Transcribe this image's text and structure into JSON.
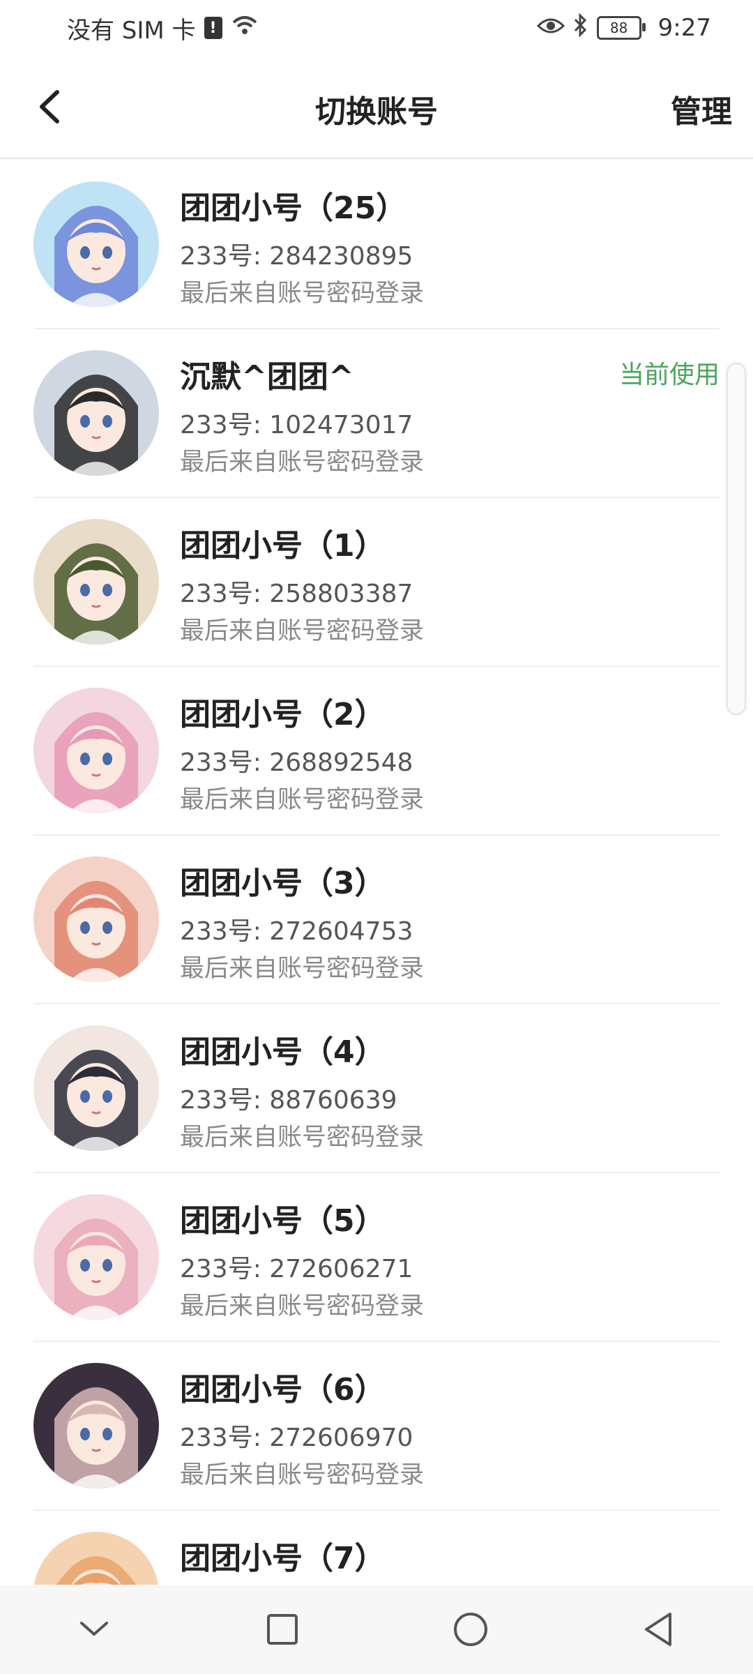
{
  "status_bar": {
    "carrier": "没有 SIM 卡",
    "sim_alert": "!",
    "battery": "88",
    "time": "9:27"
  },
  "header": {
    "title": "切换账号",
    "manage_label": "管理"
  },
  "accounts": [
    {
      "name": "团团小号（25）",
      "id": "233号: 284230895",
      "login": "最后来自账号密码登录",
      "current": "",
      "avatar_bg": "#bfe3f5",
      "avatar_fg": "#6d86d8"
    },
    {
      "name": "沉默^团团^",
      "id": "233号: 102473017",
      "login": "最后来自账号密码登录",
      "current": "当前使用",
      "avatar_bg": "#cfd8e2",
      "avatar_fg": "#2a2a2a"
    },
    {
      "name": "团团小号（1）",
      "id": "233号: 258803387",
      "login": "最后来自账号密码登录",
      "current": "",
      "avatar_bg": "#e9dcc8",
      "avatar_fg": "#4a5a2e"
    },
    {
      "name": "团团小号（2）",
      "id": "233号: 268892548",
      "login": "最后来自账号密码登录",
      "current": "",
      "avatar_bg": "#f3d6e0",
      "avatar_fg": "#e79ab6"
    },
    {
      "name": "团团小号（3）",
      "id": "233号: 272604753",
      "login": "最后来自账号密码登录",
      "current": "",
      "avatar_bg": "#f4d2c8",
      "avatar_fg": "#e2876f"
    },
    {
      "name": "团团小号（4）",
      "id": "233号: 88760639",
      "login": "最后来自账号密码登录",
      "current": "",
      "avatar_bg": "#f2e6e0",
      "avatar_fg": "#2d2d3a"
    },
    {
      "name": "团团小号（5）",
      "id": "233号: 272606271",
      "login": "最后来自账号密码登录",
      "current": "",
      "avatar_bg": "#f6d9de",
      "avatar_fg": "#e9a9b8"
    },
    {
      "name": "团团小号（6）",
      "id": "233号: 272606970",
      "login": "最后来自账号密码登录",
      "current": "",
      "avatar_bg": "#3a2f3e",
      "avatar_fg": "#d7b6b6"
    },
    {
      "name": "团团小号（7）",
      "id": "",
      "login": "",
      "current": "",
      "avatar_bg": "#f6d3b0",
      "avatar_fg": "#e9a36a"
    }
  ],
  "accent_color": "#4aa55c"
}
